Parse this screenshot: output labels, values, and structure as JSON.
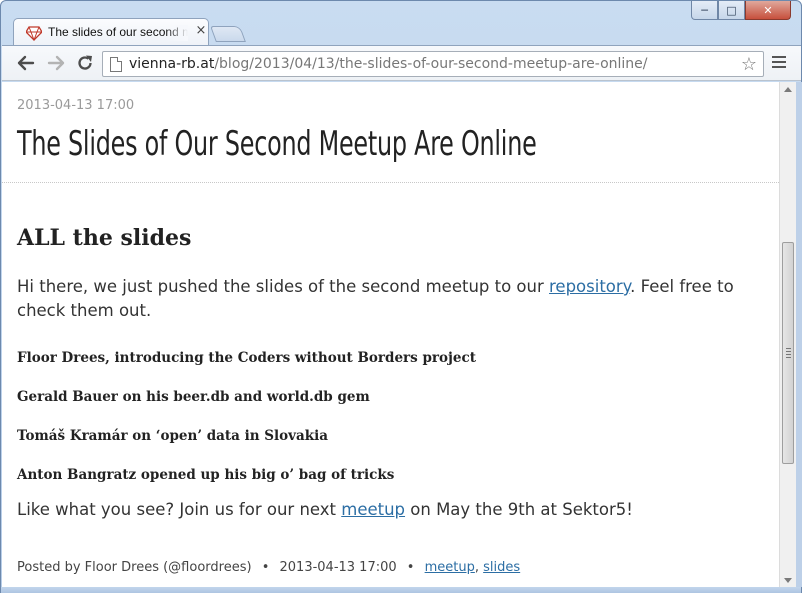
{
  "browser": {
    "tab_title": "The slides of our second meetup are online",
    "url_host": "vienna-rb.at",
    "url_path": "/blog/2013/04/13/the-slides-of-our-second-meetup-are-online/",
    "icons": {
      "favicon": "ruby-gem-icon",
      "back": "back-arrow-icon",
      "forward": "forward-arrow-icon",
      "reload": "reload-icon",
      "bookmark": "star-icon",
      "menu": "hamburger-menu-icon",
      "close_tab": "close-icon"
    },
    "window_buttons": {
      "minimize": "─",
      "maximize": "□",
      "close": "✕"
    }
  },
  "post": {
    "date": "2013-04-13 17:00",
    "title": "The Slides of Our Second Meetup Are Online",
    "section_heading": "ALL the slides",
    "intro_before_link": "Hi there, we just pushed the slides of the second meetup to our ",
    "intro_link": "repository",
    "intro_after_link": ". Feel free to check them out.",
    "items": [
      "Floor Drees, introducing the Coders without Borders project",
      "Gerald Bauer on his beer.db and world.db gem",
      "Tomáš Kramár on ‘open’ data in Slovakia",
      "Anton Bangratz opened up his big o’ bag of tricks"
    ],
    "cta_before_link": "Like what you see? Join us for our next ",
    "cta_link": "meetup",
    "cta_after_link": " on May the 9th at Sektor5!",
    "footer_posted_by": "Posted by Floor Drees (@floordrees)",
    "footer_bullet": "•",
    "footer_date": "2013-04-13 17:00",
    "footer_tags": [
      "meetup",
      "slides"
    ],
    "footer_tag_sep": ","
  },
  "colors": {
    "link": "#2c6ea4",
    "text": "#333333",
    "muted": "#9a9a9a"
  }
}
